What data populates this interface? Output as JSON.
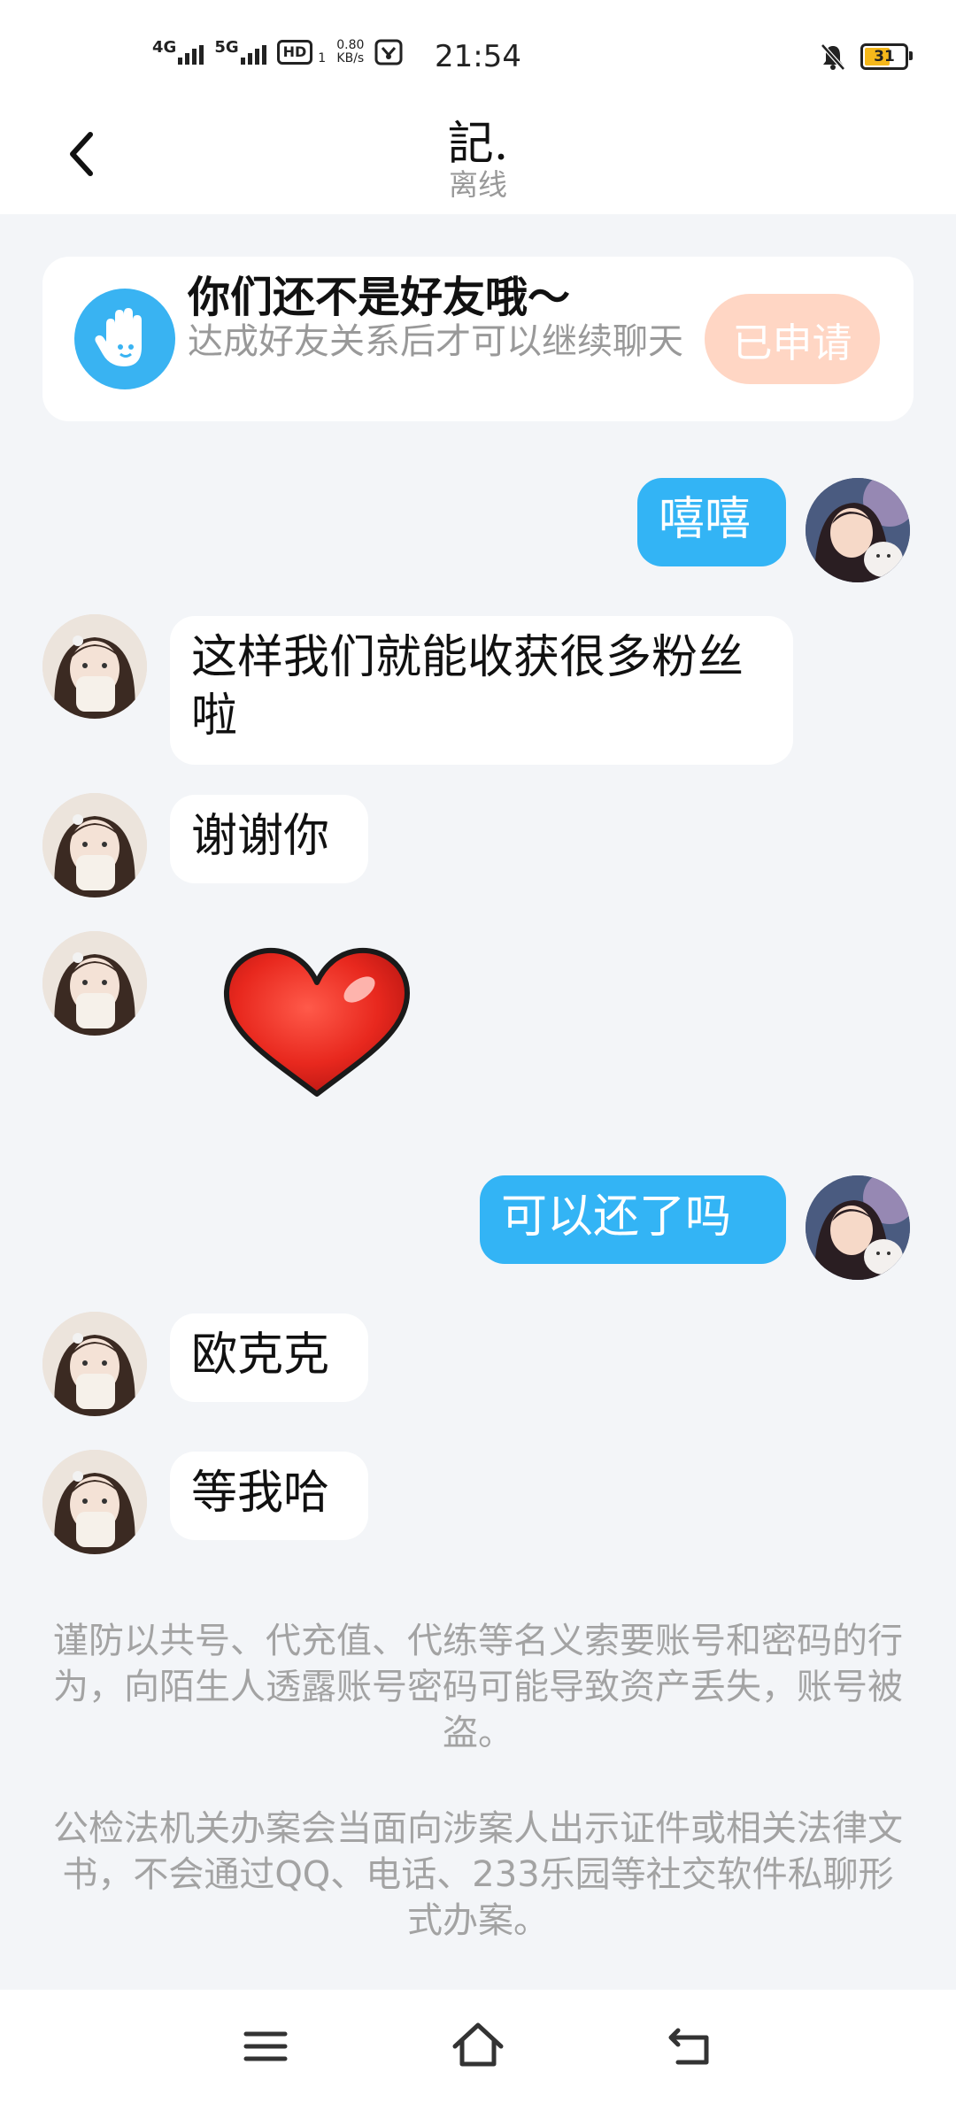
{
  "status_bar": {
    "signal1_label": "4G",
    "signal2_label": "5G",
    "hd_label": "HD",
    "hd_sub": "1",
    "net_speed_value": "0.80",
    "net_speed_unit": "KB/s",
    "time": "21:54",
    "battery": "31"
  },
  "header": {
    "title": "記.",
    "status": "离线"
  },
  "friend_card": {
    "title": "你们还不是好友哦～",
    "description": "达成好友关系后才可以继续聊天",
    "button_label": "已申请"
  },
  "messages": [
    {
      "sender": "me",
      "text": "嘻嘻"
    },
    {
      "sender": "other",
      "text": "这样我们就能收获很多粉丝啦"
    },
    {
      "sender": "other",
      "text": "谢谢你"
    },
    {
      "sender": "other",
      "sticker": "heart-sticker"
    },
    {
      "sender": "me",
      "text": "可以还了吗"
    },
    {
      "sender": "other",
      "text": "欧克克"
    },
    {
      "sender": "other",
      "text": "等我哈"
    }
  ],
  "notices": [
    "谨防以共号、代充值、代练等名义索要账号和密码的行为，向陌生人透露账号密码可能导致资产丢失，账号被盗。",
    "公检法机关办案会当面向涉案人出示证件或相关法律文书，不会通过QQ、电话、233乐园等社交软件私聊形式办案。"
  ],
  "colors": {
    "accent": "#33b4f5",
    "applied_button": "#ffd6c4",
    "background": "#f3f5f8"
  }
}
